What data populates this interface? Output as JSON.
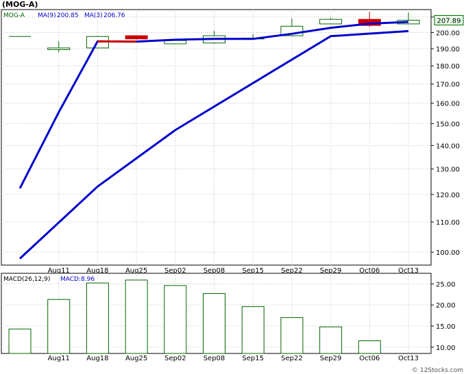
{
  "title": "(MOG-A)",
  "legend": {
    "symbol": "MOG-A",
    "ma9_label": "MA(9)",
    "ma9_value": "200.85",
    "ma3_label": "MA(3)",
    "ma3_value": "206.76"
  },
  "last_price_label": "207.89",
  "macd_legend": {
    "params": "MACD(26,12,9)",
    "value_label": "MACD:8.96"
  },
  "watermark": "© 12Stocks.com",
  "colors": {
    "up": "#006400",
    "down": "#cc0000",
    "ma_line": "#0000cc",
    "grid": "#c0c0c0",
    "macd_bar": "#006400",
    "price_box": "#e6ffe6"
  },
  "chart_data": [
    {
      "type": "candlestick",
      "x_tick_labels": [
        "Aug11",
        "Aug18",
        "Aug25",
        "Sep02",
        "Sep08",
        "Sep15",
        "Sep22",
        "Sep29",
        "Oct06",
        "Oct13"
      ],
      "y_ticks": [
        100,
        110,
        120,
        130,
        140,
        150,
        160,
        170,
        180,
        190,
        200,
        210
      ],
      "y_tick_labels": [
        "100.00",
        "110.00",
        "120.00",
        "130.00",
        "140.00",
        "150.00",
        "160.00",
        "170.00",
        "180.00",
        "190.00",
        "200.00",
        "210.00"
      ],
      "ylim": [
        96,
        215
      ],
      "scale": "log",
      "grid": true,
      "candles": [
        {
          "open": 197.5,
          "high": 197.5,
          "low": 197.5,
          "close": 197.5
        },
        {
          "open": 189.5,
          "high": 194.5,
          "low": 188.0,
          "close": 190.5
        },
        {
          "open": 190.5,
          "high": 198.0,
          "low": 190.5,
          "close": 197.5
        },
        {
          "open": 198.0,
          "high": 198.0,
          "low": 195.5,
          "close": 196.0
        },
        {
          "open": 193.0,
          "high": 196.0,
          "low": 193.0,
          "close": 195.0
        },
        {
          "open": 193.5,
          "high": 201.0,
          "low": 193.0,
          "close": 198.0
        },
        {
          "open": 196.0,
          "high": 199.0,
          "low": 196.0,
          "close": 196.5
        },
        {
          "open": 198.0,
          "high": 209.0,
          "low": 197.5,
          "close": 204.0
        },
        {
          "open": 205.5,
          "high": 209.5,
          "low": 205.5,
          "close": 208.5
        },
        {
          "open": 208.5,
          "high": 213.5,
          "low": 203.5,
          "close": 204.5
        },
        {
          "open": 205.5,
          "high": 213.0,
          "low": 205.5,
          "close": 207.9
        }
      ],
      "series": [
        {
          "name": "MA(3)",
          "values": [
            122.3,
            155.5,
            194.5,
            194.3,
            195.5,
            196.0,
            196.0,
            199.2,
            203.0,
            205.7,
            206.8
          ],
          "color_segments": {
            "red_from": 2,
            "red_to": 3
          }
        },
        {
          "name": "MA(9)",
          "values": [
            98.0,
            null,
            123.0,
            null,
            147.0,
            null,
            170.5,
            null,
            197.7,
            null,
            200.9
          ]
        }
      ]
    },
    {
      "type": "bar",
      "title": "MACD(26,12,9)",
      "y_ticks": [
        10,
        15,
        20,
        25
      ],
      "y_tick_labels": [
        "10.00",
        "15.00",
        "20.00",
        "25.00"
      ],
      "ylim": [
        8.5,
        27.5
      ],
      "grid": true,
      "values": [
        14.3,
        21.3,
        25.2,
        25.9,
        24.6,
        22.7,
        19.6,
        17.0,
        14.8,
        11.5,
        null
      ]
    }
  ]
}
